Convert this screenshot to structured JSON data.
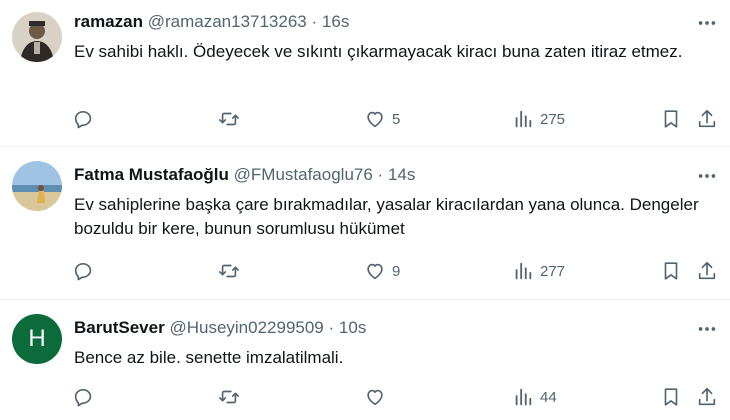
{
  "tweets": [
    {
      "name": "ramazan",
      "handle": "@ramazan13713263",
      "dot": "·",
      "time": "16s",
      "text": "Ev sahibi haklı. Ödeyecek ve sıkıntı çıkarmayacak kiracı buna zaten itiraz etmez.",
      "replies": "",
      "retweets": "",
      "likes": "5",
      "views": "275",
      "avatar_icon": "person-photo-icon"
    },
    {
      "name": "Fatma Mustafaoğlu",
      "handle": "@FMustafaoglu76",
      "dot": "·",
      "time": "14s",
      "text": "Ev sahiplerine başka çare bırakmadılar, yasalar kiracılardan yana olunca. Dengeler bozuldu bir kere, bunun sorumlusu hükümet",
      "replies": "",
      "retweets": "",
      "likes": "9",
      "views": "277",
      "avatar_icon": "beach-photo-icon"
    },
    {
      "name": "BarutSever",
      "handle": "@Huseyin02299509",
      "dot": "·",
      "time": "10s",
      "text": "Bence az bile. senette imzalatilmali.",
      "replies": "",
      "retweets": "",
      "likes": "",
      "views": "44",
      "avatar_letter": "H",
      "avatar_color": "#0b6b3a"
    }
  ],
  "colors": {
    "text": "#0f1419",
    "secondary": "#536471",
    "divider": "#eff3f4"
  }
}
